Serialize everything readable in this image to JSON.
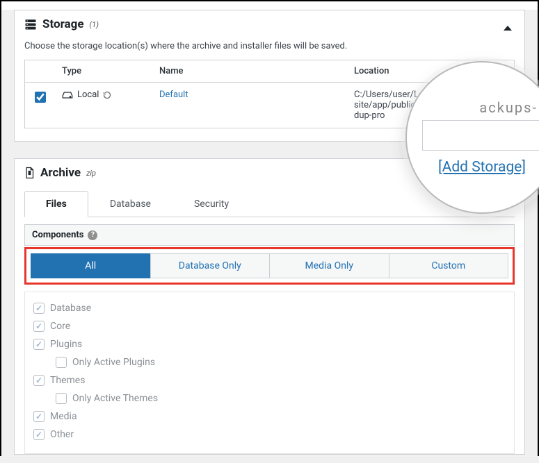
{
  "storage_panel": {
    "title": "Storage",
    "count_sup": "(1)",
    "description": "Choose the storage location(s) where the archive and installer files will be saved.",
    "columns": {
      "type": "Type",
      "name": "Name",
      "location": "Location"
    },
    "rows": [
      {
        "checked": true,
        "type_label": "Local",
        "name": "Default",
        "location": "C:/Users/user/Local site/app/public/ dup-pro"
      }
    ]
  },
  "archive_panel": {
    "title": "Archive",
    "ext_sup": "zip",
    "tabs": [
      {
        "key": "files",
        "label": "Files",
        "active": true
      },
      {
        "key": "database",
        "label": "Database",
        "active": false
      },
      {
        "key": "security",
        "label": "Security",
        "active": false
      }
    ],
    "components_header": "Components",
    "segments": [
      {
        "key": "all",
        "label": "All",
        "active": true
      },
      {
        "key": "db",
        "label": "Database Only",
        "active": false
      },
      {
        "key": "media",
        "label": "Media Only",
        "active": false
      },
      {
        "key": "custom",
        "label": "Custom",
        "active": false
      }
    ],
    "components": [
      {
        "label": "Database",
        "checked": true,
        "indent": false
      },
      {
        "label": "Core",
        "checked": true,
        "indent": false
      },
      {
        "label": "Plugins",
        "checked": true,
        "indent": false
      },
      {
        "label": "Only Active Plugins",
        "checked": false,
        "indent": true
      },
      {
        "label": "Themes",
        "checked": true,
        "indent": false
      },
      {
        "label": "Only Active Themes",
        "checked": false,
        "indent": true
      },
      {
        "label": "Media",
        "checked": true,
        "indent": false
      },
      {
        "label": "Other",
        "checked": true,
        "indent": false
      }
    ]
  },
  "lens": {
    "faded_text": "ackups-",
    "link": "[Add Storage]"
  }
}
